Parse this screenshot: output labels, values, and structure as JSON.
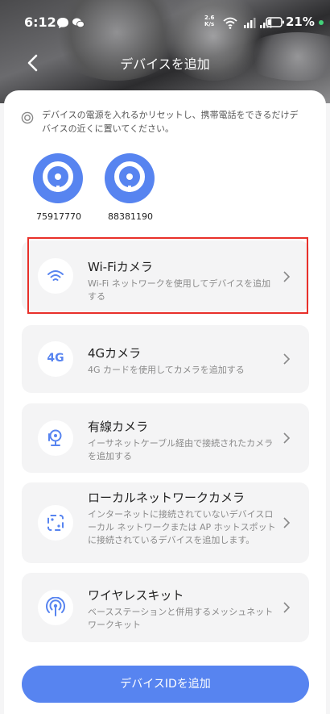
{
  "status": {
    "time": "6:12",
    "battery": "21%",
    "net_speed": "2.6 K/s"
  },
  "header": {
    "title": "デバイスを追加"
  },
  "tip": {
    "text": "デバイスの電源を入れるかリセットし、携帯電話をできるだけデバイスの近くに置いてください。"
  },
  "devices": [
    {
      "id": "75917770"
    },
    {
      "id": "88381190"
    }
  ],
  "cards": [
    {
      "title": "Wi-Fiカメラ",
      "desc": "Wi-Fi ネットワークを使用してデバイスを追加する",
      "icon": "wifi-icon"
    },
    {
      "title": "4Gカメラ",
      "desc": "4G カードを使用してカメラを追加する",
      "icon": "4g-icon",
      "icon_text": "4G"
    },
    {
      "title": "有線カメラ",
      "desc": "イーサネットケーブル経由で接続されたカメラを追加する",
      "icon": "wired-camera-icon"
    },
    {
      "title": "ローカルネットワークカメラ",
      "desc": "インターネットに接続されていないデバイスローカル ネットワークまたは AP ホットスポットに接続されているデバイスを追加します。",
      "icon": "lan-icon"
    },
    {
      "title": "ワイヤレスキット",
      "desc": "ベースステーションと併用するメッシュネットワークキット",
      "icon": "wireless-kit-icon"
    }
  ],
  "primary_button": {
    "label": "デバイスIDを追加"
  },
  "colors": {
    "accent": "#5784f0",
    "highlight": "#e8302a",
    "card_bg": "#f4f4f5"
  }
}
